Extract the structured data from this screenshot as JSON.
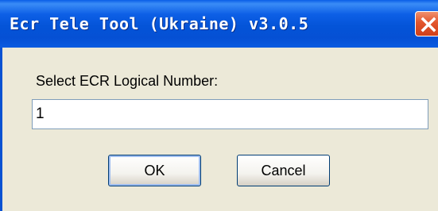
{
  "window": {
    "title": "Ecr Tele Tool (Ukraine) v3.0.5",
    "close_icon": "close-x-icon"
  },
  "dialog": {
    "prompt": "Select ECR Logical Number:",
    "input_value": "1",
    "ok_label": "OK",
    "cancel_label": "Cancel"
  },
  "colors": {
    "titlebar": "#0a5ee8",
    "close_button": "#e2552c",
    "window_bg": "#ece9d8"
  }
}
